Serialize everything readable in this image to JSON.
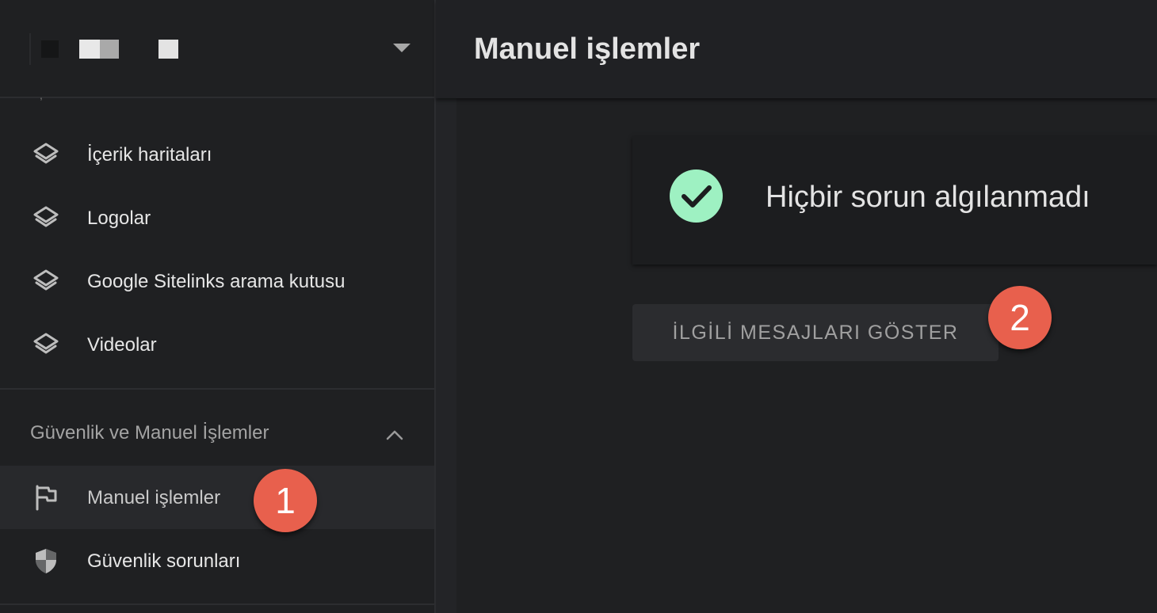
{
  "sidebar": {
    "items": [
      {
        "label": "İçerik haritaları",
        "icon": "layers-icon"
      },
      {
        "label": "Logolar",
        "icon": "layers-icon"
      },
      {
        "label": "Google Sitelinks arama kutusu",
        "icon": "layers-icon"
      },
      {
        "label": "Videolar",
        "icon": "layers-icon"
      }
    ],
    "section": {
      "title": "Güvenlik ve Manuel İşlemler",
      "expanded": true,
      "items": [
        {
          "label": "Manuel işlemler",
          "icon": "flag-icon",
          "active": true
        },
        {
          "label": "Güvenlik sorunları",
          "icon": "shield-icon",
          "active": false
        }
      ]
    }
  },
  "header": {
    "title": "Manuel işlemler"
  },
  "main": {
    "status_text": "Hiçbir sorun algılanmadı",
    "status_icon": "check-circle-icon",
    "button_label": "İLGİLİ MESAJLARI GÖSTER"
  },
  "markers": {
    "one": "1",
    "two": "2"
  },
  "colors": {
    "success": "#9ef1c2",
    "marker": "#e8604d",
    "background": "#1f2022"
  }
}
